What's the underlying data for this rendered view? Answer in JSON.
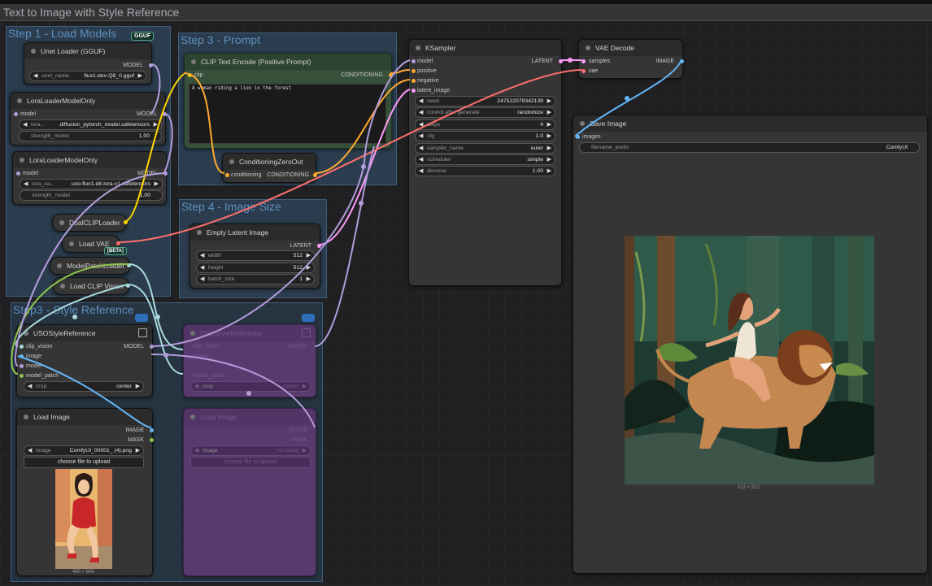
{
  "workflow_title": "Text to Image with Style Reference",
  "groups": {
    "step1": "Step 1 - Load Models",
    "step3_prompt": "Step 3 - Prompt",
    "step4": "Step 4 - Image Size",
    "step3_style": "Step3 - Style Reference"
  },
  "badges": {
    "gguf": "GGUF",
    "beta": "[BETA]"
  },
  "unet_loader": {
    "title": "Unet Loader (GGUF)",
    "out": "MODEL",
    "widget_name": "unet_name",
    "widget_value": "flux1-dev-Q8_0.gguf"
  },
  "lora1": {
    "title": "LoraLoaderModelOnly",
    "in": "model",
    "out": "MODEL",
    "lora_name": "lora...",
    "lora_value": "diffusion_pytorch_model.safetensors",
    "strength_name": "strength_model",
    "strength_value": "1.00"
  },
  "lora2": {
    "title": "LoraLoaderModelOnly",
    "in": "model",
    "out": "MODEL",
    "lora_name": "lora_na...",
    "lora_value": "uso-flux1-dit-lora-v1.safetensors",
    "strength_name": "strength_model",
    "strength_value": "1.00"
  },
  "collapsed": {
    "dualclip": "DualCLIPLoader",
    "loadvae": "Load VAE",
    "patch": "ModelPatchLoader",
    "clipvision": "Load CLIP Vision"
  },
  "clip_text": {
    "title": "CLIP Text Encode (Positive Prompt)",
    "in": "clip",
    "out": "CONDITIONING",
    "prompt": "A woman riding a lion in the forest"
  },
  "cond_zero": {
    "title": "ConditioningZeroOut",
    "in": "conditioning",
    "out": "CONDITIONING"
  },
  "empty_latent": {
    "title": "Empty Latent Image",
    "out": "LATENT",
    "widgets": [
      {
        "name": "width",
        "value": "512"
      },
      {
        "name": "height",
        "value": "512"
      },
      {
        "name": "batch_size",
        "value": "1"
      }
    ]
  },
  "ksampler": {
    "title": "KSampler",
    "out": "LATENT",
    "inputs": [
      "model",
      "positive",
      "negative",
      "latent_image"
    ],
    "widgets": [
      {
        "name": "seed",
        "value": "247522079342139"
      },
      {
        "name": "control after generate",
        "value": "randomize"
      },
      {
        "name": "steps",
        "value": "4"
      },
      {
        "name": "cfg",
        "value": "1.0"
      },
      {
        "name": "sampler_name",
        "value": "euler"
      },
      {
        "name": "scheduler",
        "value": "simple"
      },
      {
        "name": "denoise",
        "value": "1.00"
      }
    ]
  },
  "vae_decode": {
    "title": "VAE Decode",
    "in1": "samples",
    "in2": "vae",
    "out": "IMAGE"
  },
  "save_image": {
    "title": "Save Image",
    "in": "images",
    "widget_name": "filename_prefix",
    "widget_value": "ComfyUI",
    "caption": "512 × 512"
  },
  "uso1": {
    "title": "USOStyleReference",
    "inputs": [
      "clip_vision",
      "image",
      "model",
      "model_patch"
    ],
    "out": "MODEL",
    "widget_name": "crop",
    "widget_value": "center"
  },
  "uso2": {
    "title": "USOStyleReference",
    "inputs": [
      "clip_vision",
      "image",
      "model_patch"
    ],
    "out": "MODEL",
    "widget_name": "crop",
    "widget_value": "center"
  },
  "load_image1": {
    "title": "Load Image",
    "out1": "IMAGE",
    "out2": "MASK",
    "widget_name": "image",
    "widget_value": "ComfyUI_00001_ (4).png",
    "upload": "choose file to upload",
    "caption": "480 × 848"
  },
  "load_image2": {
    "title": "Load Image",
    "out1": "IMAGE",
    "out2": "MASK",
    "widget_name": "image",
    "widget_value": "ref.webp",
    "upload": "choose file to upload"
  },
  "colors": {
    "model": "#b39ddb",
    "clip": "#ffd500",
    "conditioning": "#ffa931",
    "latent": "#ff9cf9",
    "vae": "#ff6e6e",
    "image": "#64b5f6",
    "clip_vision": "#a8dadc",
    "group": "#3a638a",
    "bypass": "#5f3b74"
  }
}
